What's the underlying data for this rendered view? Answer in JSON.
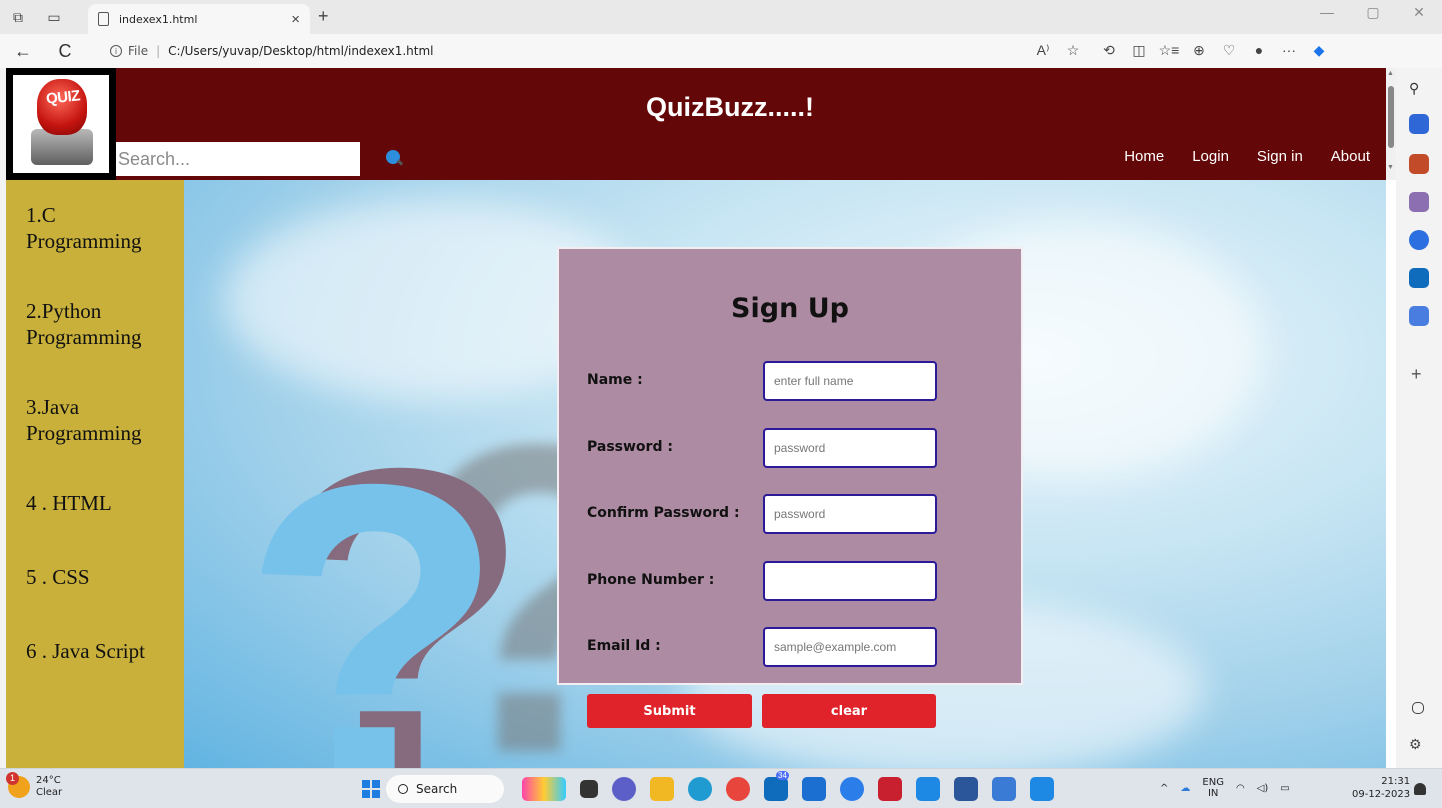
{
  "browser": {
    "tab_title": "indexex1.html",
    "tab_close": "×",
    "new_tab": "+",
    "address_scheme_label": "File",
    "address_separator": "|",
    "address_url": "C:/Users/yuvap/Desktop/html/indexex1.html",
    "back_glyph": "←",
    "refresh_glyph": "C",
    "more_glyph": "···",
    "minimize_glyph": "—",
    "restore_glyph": "▢",
    "close_glyph": "✕"
  },
  "header": {
    "logo_text": "QUIZ",
    "site_title": "QuizBuzz.....!",
    "search_placeholder": "Search...",
    "nav": [
      "Home",
      "Login",
      "Sign in",
      "About"
    ]
  },
  "sidebar": {
    "items": [
      "1.C Programming",
      "2.Python Programming",
      "3.Java Programming",
      "4 . HTML",
      "5 . CSS",
      "6 . Java Script"
    ]
  },
  "form": {
    "title": "Sign Up",
    "fields": [
      {
        "label": "Name :",
        "placeholder": "enter full name"
      },
      {
        "label": "Password :",
        "placeholder": "password"
      },
      {
        "label": "Confirm Password :",
        "placeholder": "password"
      },
      {
        "label": "Phone Number :",
        "placeholder": ""
      },
      {
        "label": "Email Id :",
        "placeholder": "sample@example.com"
      }
    ],
    "submit_label": "Submit",
    "clear_label": "clear"
  },
  "background": {
    "question_mark": "?"
  },
  "taskbar": {
    "weather_badge": "1",
    "temperature": "24°C",
    "condition": "Clear",
    "search_label": "Search",
    "app_badge": "34",
    "lang_top": "ENG",
    "lang_bottom": "IN",
    "time": "21:31",
    "date": "09-12-2023"
  },
  "colors": {
    "header_bg": "#640708",
    "sidebar_bg": "#c8b03a",
    "form_bg": "#ad8ba2",
    "button_bg": "#e0232a",
    "input_border": "#2d1a99"
  }
}
